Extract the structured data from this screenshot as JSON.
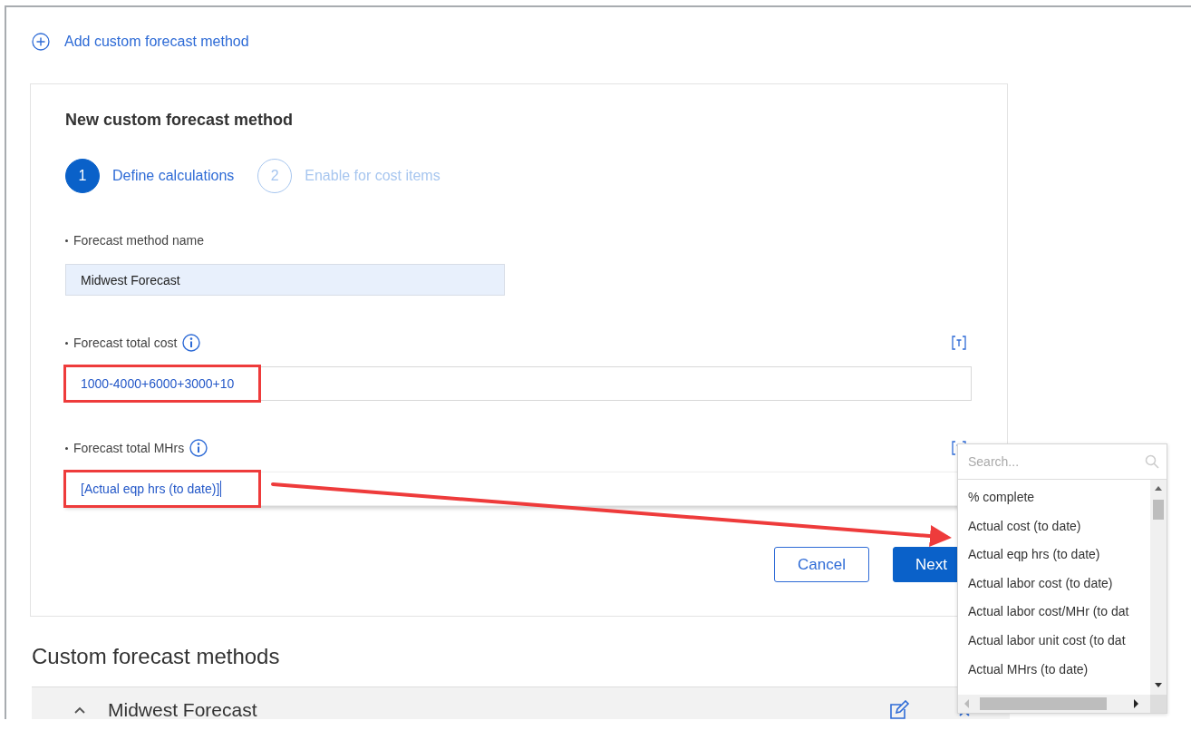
{
  "add_link": {
    "label": "Add custom forecast method"
  },
  "form": {
    "title": "New custom forecast method",
    "steps": [
      {
        "number": "1",
        "label": "Define calculations",
        "selected": true
      },
      {
        "number": "2",
        "label": "Enable for cost items",
        "selected": false
      }
    ],
    "fields": [
      {
        "kind": "name",
        "label": "Forecast method name",
        "required": true,
        "value": "Midwest Forecast",
        "highlighted": false
      },
      {
        "kind": "formula",
        "label": "Forecast total cost",
        "required": true,
        "value": "1000-4000+6000+3000+10",
        "highlighted": true
      },
      {
        "kind": "formula",
        "label": "Forecast total MHrs",
        "required": true,
        "value": "[Actual eqp hrs (to date)]",
        "highlighted": true,
        "focused": true
      }
    ],
    "buttons": [
      {
        "kind": "secondary",
        "label": "Cancel"
      },
      {
        "kind": "primary",
        "label": "Next"
      }
    ]
  },
  "custom_methods": {
    "heading": "Custom forecast methods",
    "rows": [
      {
        "name": "Midwest Forecast",
        "expanded": true
      }
    ]
  },
  "dropdown": {
    "search_placeholder": "Search...",
    "items": [
      "% complete",
      "Actual cost (to date)",
      "Actual eqp hrs (to date)",
      "Actual labor cost (to date)",
      "Actual labor cost/MHr (to dat",
      "Actual labor unit cost (to dat",
      "Actual MHrs (to date)"
    ]
  }
}
